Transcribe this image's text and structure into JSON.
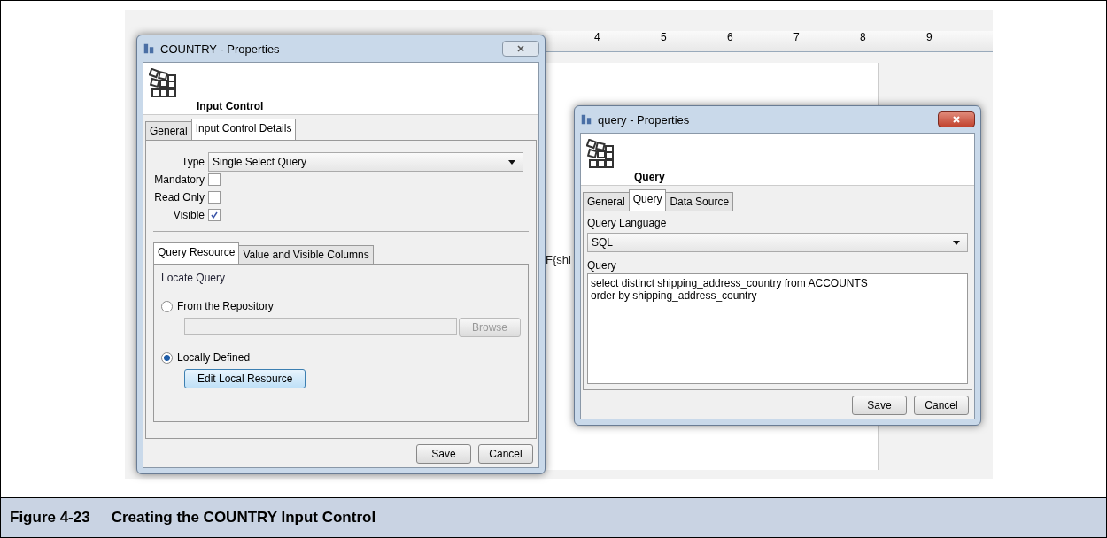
{
  "background": {
    "ruler_ticks": [
      "4",
      "5",
      "6",
      "7",
      "8",
      "9"
    ],
    "expression_fragment": "F{shi"
  },
  "country_dialog": {
    "title": "COUNTRY - Properties",
    "heading": "Input Control",
    "tabs": [
      {
        "label": "General",
        "selected": false
      },
      {
        "label": "Input Control Details",
        "selected": true
      }
    ],
    "type_label": "Type",
    "type_value": "Single Select Query",
    "checkboxes": [
      {
        "label": "Mandatory",
        "checked": false
      },
      {
        "label": "Read Only",
        "checked": false
      },
      {
        "label": "Visible",
        "checked": true
      }
    ],
    "subtabs": [
      {
        "label": "Query Resource",
        "selected": true
      },
      {
        "label": "Value and Visible Columns",
        "selected": false
      }
    ],
    "group_label": "Locate Query",
    "radios": [
      {
        "label": "From the Repository",
        "selected": false
      },
      {
        "label": "Locally Defined",
        "selected": true
      }
    ],
    "browse_button": {
      "label": "Browse",
      "disabled": true
    },
    "edit_button": "Edit Local Resource",
    "buttons": [
      "Save",
      "Cancel"
    ]
  },
  "query_dialog": {
    "title": "query - Properties",
    "heading": "Query",
    "tabs": [
      {
        "label": "General",
        "selected": false
      },
      {
        "label": "Query",
        "selected": true
      },
      {
        "label": "Data Source",
        "selected": false
      }
    ],
    "language_label": "Query Language",
    "language_value": "SQL",
    "query_label": "Query",
    "query_text": "select distinct shipping_address_country from ACCOUNTS\norder by shipping_address_country",
    "buttons": [
      "Save",
      "Cancel"
    ]
  },
  "figure": {
    "caption_label": "Figure 4-23",
    "caption_text": "Creating the COUNTRY Input Control"
  }
}
